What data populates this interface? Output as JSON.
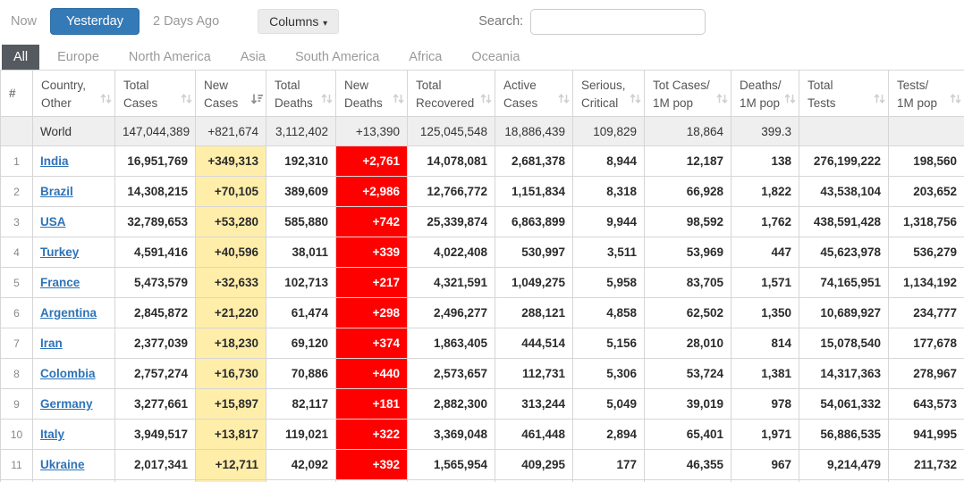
{
  "toolbar": {
    "now_label": "Now",
    "yesterday_label": "Yesterday",
    "two_days_ago_label": "2 Days Ago",
    "columns_label": "Columns",
    "search_label": "Search:",
    "search_value": ""
  },
  "tabs": [
    {
      "label": "All",
      "active": true
    },
    {
      "label": "Europe",
      "active": false
    },
    {
      "label": "North America",
      "active": false
    },
    {
      "label": "Asia",
      "active": false
    },
    {
      "label": "South America",
      "active": false
    },
    {
      "label": "Africa",
      "active": false
    },
    {
      "label": "Oceania",
      "active": false
    }
  ],
  "colors": {
    "accent_blue": "#337ab7",
    "active_tab_bg": "#555a60",
    "new_cases_highlight": "#FFEEAA",
    "new_deaths_highlight": "#FF0000",
    "link_blue": "#2e73b8"
  },
  "table": {
    "columns": [
      {
        "line1": "#",
        "line2": "",
        "sort": "none"
      },
      {
        "line1": "Country,",
        "line2": "Other",
        "sort": "unsorted"
      },
      {
        "line1": "Total",
        "line2": "Cases",
        "sort": "unsorted"
      },
      {
        "line1": "New",
        "line2": "Cases",
        "sort": "desc"
      },
      {
        "line1": "Total",
        "line2": "Deaths",
        "sort": "unsorted"
      },
      {
        "line1": "New",
        "line2": "Deaths",
        "sort": "unsorted"
      },
      {
        "line1": "Total",
        "line2": "Recovered",
        "sort": "unsorted"
      },
      {
        "line1": "Active",
        "line2": "Cases",
        "sort": "unsorted"
      },
      {
        "line1": "Serious,",
        "line2": "Critical",
        "sort": "unsorted"
      },
      {
        "line1": "Tot Cases/",
        "line2": "1M pop",
        "sort": "unsorted"
      },
      {
        "line1": "Deaths/",
        "line2": "1M pop",
        "sort": "unsorted"
      },
      {
        "line1": "Total",
        "line2": "Tests",
        "sort": "unsorted"
      },
      {
        "line1": "Tests/",
        "line2": "1M pop",
        "sort": "unsorted"
      }
    ],
    "world_row": {
      "name": "World",
      "values": [
        "147,044,389",
        "+821,674",
        "3,112,402",
        "+13,390",
        "125,045,548",
        "18,886,439",
        "109,829",
        "18,864",
        "399.3",
        "",
        ""
      ]
    },
    "rows": [
      {
        "rank": "1",
        "country": "India",
        "values": [
          "16,951,769",
          "+349,313",
          "192,310",
          "+2,761",
          "14,078,081",
          "2,681,378",
          "8,944",
          "12,187",
          "138",
          "276,199,222",
          "198,560"
        ]
      },
      {
        "rank": "2",
        "country": "Brazil",
        "values": [
          "14,308,215",
          "+70,105",
          "389,609",
          "+2,986",
          "12,766,772",
          "1,151,834",
          "8,318",
          "66,928",
          "1,822",
          "43,538,104",
          "203,652"
        ]
      },
      {
        "rank": "3",
        "country": "USA",
        "values": [
          "32,789,653",
          "+53,280",
          "585,880",
          "+742",
          "25,339,874",
          "6,863,899",
          "9,944",
          "98,592",
          "1,762",
          "438,591,428",
          "1,318,756"
        ]
      },
      {
        "rank": "4",
        "country": "Turkey",
        "values": [
          "4,591,416",
          "+40,596",
          "38,011",
          "+339",
          "4,022,408",
          "530,997",
          "3,511",
          "53,969",
          "447",
          "45,623,978",
          "536,279"
        ]
      },
      {
        "rank": "5",
        "country": "France",
        "values": [
          "5,473,579",
          "+32,633",
          "102,713",
          "+217",
          "4,321,591",
          "1,049,275",
          "5,958",
          "83,705",
          "1,571",
          "74,165,951",
          "1,134,192"
        ]
      },
      {
        "rank": "6",
        "country": "Argentina",
        "values": [
          "2,845,872",
          "+21,220",
          "61,474",
          "+298",
          "2,496,277",
          "288,121",
          "4,858",
          "62,502",
          "1,350",
          "10,689,927",
          "234,777"
        ]
      },
      {
        "rank": "7",
        "country": "Iran",
        "values": [
          "2,377,039",
          "+18,230",
          "69,120",
          "+374",
          "1,863,405",
          "444,514",
          "5,156",
          "28,010",
          "814",
          "15,078,540",
          "177,678"
        ]
      },
      {
        "rank": "8",
        "country": "Colombia",
        "values": [
          "2,757,274",
          "+16,730",
          "70,886",
          "+440",
          "2,573,657",
          "112,731",
          "5,306",
          "53,724",
          "1,381",
          "14,317,363",
          "278,967"
        ]
      },
      {
        "rank": "9",
        "country": "Germany",
        "values": [
          "3,277,661",
          "+15,897",
          "82,117",
          "+181",
          "2,882,300",
          "313,244",
          "5,049",
          "39,019",
          "978",
          "54,061,332",
          "643,573"
        ]
      },
      {
        "rank": "10",
        "country": "Italy",
        "values": [
          "3,949,517",
          "+13,817",
          "119,021",
          "+322",
          "3,369,048",
          "461,448",
          "2,894",
          "65,401",
          "1,971",
          "56,886,535",
          "941,995"
        ]
      },
      {
        "rank": "11",
        "country": "Ukraine",
        "values": [
          "2,017,341",
          "+12,711",
          "42,092",
          "+392",
          "1,565,954",
          "409,295",
          "177",
          "46,355",
          "967",
          "9,214,479",
          "211,732"
        ]
      }
    ]
  }
}
